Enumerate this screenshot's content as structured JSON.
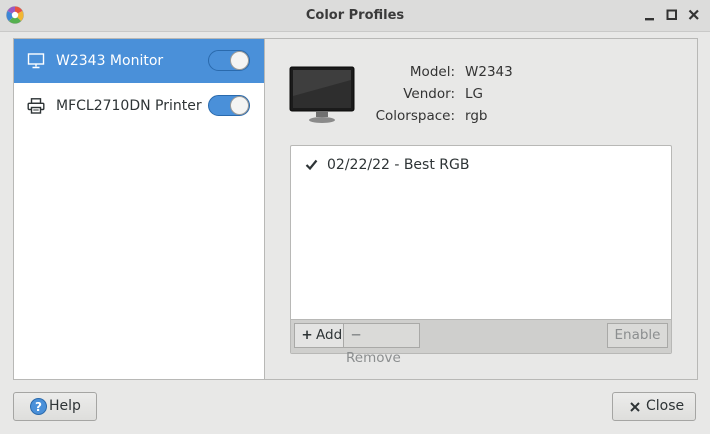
{
  "window": {
    "title": "Color Profiles"
  },
  "devices": [
    {
      "label": "W2343 Monitor",
      "icon": "monitor-icon",
      "enabled": true,
      "selected": true
    },
    {
      "label": "MFCL2710DN Printer",
      "icon": "printer-icon",
      "enabled": true,
      "selected": false
    }
  ],
  "details": {
    "model_label": "Model:",
    "model_value": "W2343",
    "vendor_label": "Vendor:",
    "vendor_value": "LG",
    "colorspace_label": "Colorspace:",
    "colorspace_value": "rgb"
  },
  "profiles": [
    {
      "label": "02/22/22 - Best RGB",
      "active": true
    }
  ],
  "profile_toolbar": {
    "add_label": "Add",
    "remove_label": "Remove",
    "enable_label": "Enable"
  },
  "footer": {
    "help_label": "Help",
    "close_label": "Close"
  },
  "colors": {
    "accent": "#4a90d9",
    "window_bg": "#e8e8e7"
  }
}
